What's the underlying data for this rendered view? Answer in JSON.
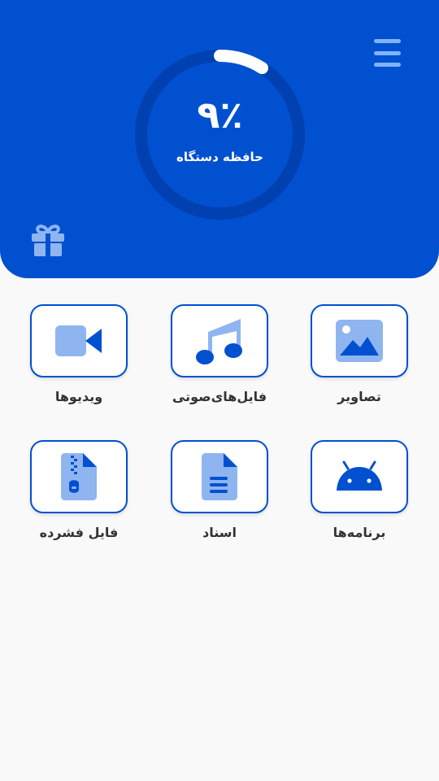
{
  "colors": {
    "primary": "#0050d0",
    "icon_light": "#8fb5f0",
    "icon_dark": "#0050d0",
    "gauge_track": "#0040b0",
    "gauge_fill": "#ffffff",
    "background": "#f9f9f9"
  },
  "header": {
    "storage_percent": "٩٪",
    "storage_fraction": 0.09,
    "storage_label": "حافظه دستگاه",
    "menu_icon": "hamburger-menu-icon",
    "gift_icon": "gift-icon"
  },
  "categories": [
    {
      "id": "images",
      "label": "تصاویر",
      "icon": "image-icon"
    },
    {
      "id": "audio",
      "label": "فایل‌های‌صوتی",
      "icon": "music-icon"
    },
    {
      "id": "videos",
      "label": "ویدیوها",
      "icon": "video-camera-icon"
    },
    {
      "id": "apps",
      "label": "برنامه‌ها",
      "icon": "android-icon"
    },
    {
      "id": "documents",
      "label": "اسناد",
      "icon": "document-icon"
    },
    {
      "id": "archives",
      "label": "فایل فشرده",
      "icon": "zip-file-icon"
    }
  ]
}
